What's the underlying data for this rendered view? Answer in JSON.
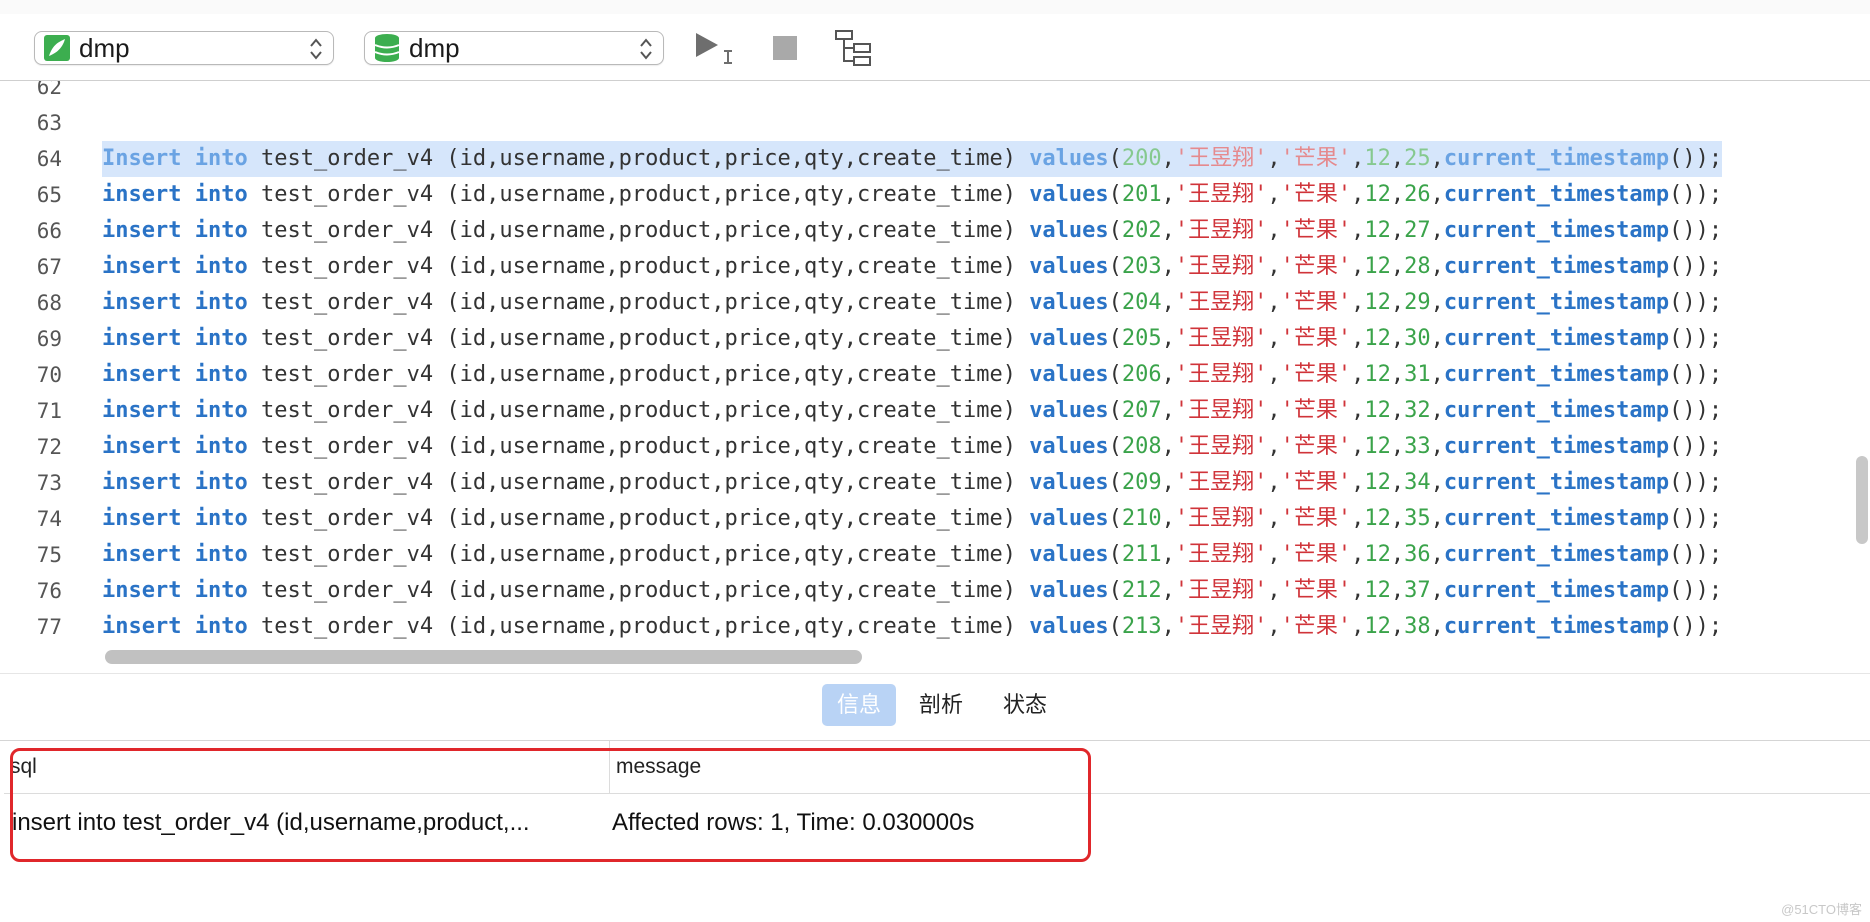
{
  "toolbar": {
    "connection_select": {
      "value": "dmp",
      "icon": "connection-icon"
    },
    "database_select": {
      "value": "dmp",
      "icon": "database-icon"
    },
    "run_icon": "run-icon",
    "stop_icon": "stop-icon",
    "explain_icon": "explain-icon"
  },
  "editor": {
    "lines": [
      {
        "num": "62",
        "code": ""
      },
      {
        "num": "63",
        "code": ""
      },
      {
        "num": "64",
        "kw": "Insert",
        "id": "200",
        "qty": "25",
        "selected": true
      },
      {
        "num": "65",
        "kw": "insert",
        "id": "201",
        "qty": "26"
      },
      {
        "num": "66",
        "kw": "insert",
        "id": "202",
        "qty": "27"
      },
      {
        "num": "67",
        "kw": "insert",
        "id": "203",
        "qty": "28"
      },
      {
        "num": "68",
        "kw": "insert",
        "id": "204",
        "qty": "29"
      },
      {
        "num": "69",
        "kw": "insert",
        "id": "205",
        "qty": "30"
      },
      {
        "num": "70",
        "kw": "insert",
        "id": "206",
        "qty": "31"
      },
      {
        "num": "71",
        "kw": "insert",
        "id": "207",
        "qty": "32"
      },
      {
        "num": "72",
        "kw": "insert",
        "id": "208",
        "qty": "33"
      },
      {
        "num": "73",
        "kw": "insert",
        "id": "209",
        "qty": "34"
      },
      {
        "num": "74",
        "kw": "insert",
        "id": "210",
        "qty": "35"
      },
      {
        "num": "75",
        "kw": "insert",
        "id": "211",
        "qty": "36"
      },
      {
        "num": "76",
        "kw": "insert",
        "id": "212",
        "qty": "37"
      },
      {
        "num": "77",
        "kw": "insert",
        "id": "213",
        "qty": "38"
      }
    ],
    "sql": {
      "into": "into",
      "table": " test_order_v4 (id,username,product,price,qty,create_time) ",
      "values_kw": "values",
      "name": "'王昱翔'",
      "product": "'芒果'",
      "price": "12",
      "fn": "current_timestamp",
      "tail": "());"
    }
  },
  "tabs": [
    {
      "label": "信息",
      "active": true
    },
    {
      "label": "剖析",
      "active": false
    },
    {
      "label": "状态",
      "active": false
    }
  ],
  "result": {
    "columns": [
      "sql",
      "message"
    ],
    "rows": [
      {
        "sql": "insert into test_order_v4 (id,username,product,...",
        "message": "Affected rows: 1, Time: 0.030000s"
      }
    ]
  },
  "watermark": "@51CTO博客",
  "colors": {
    "keyword": "#2a73c6",
    "number": "#3aa34a",
    "string": "#d0343a",
    "selection": "#d6e6fb",
    "highlight_box": "#e0272b"
  }
}
